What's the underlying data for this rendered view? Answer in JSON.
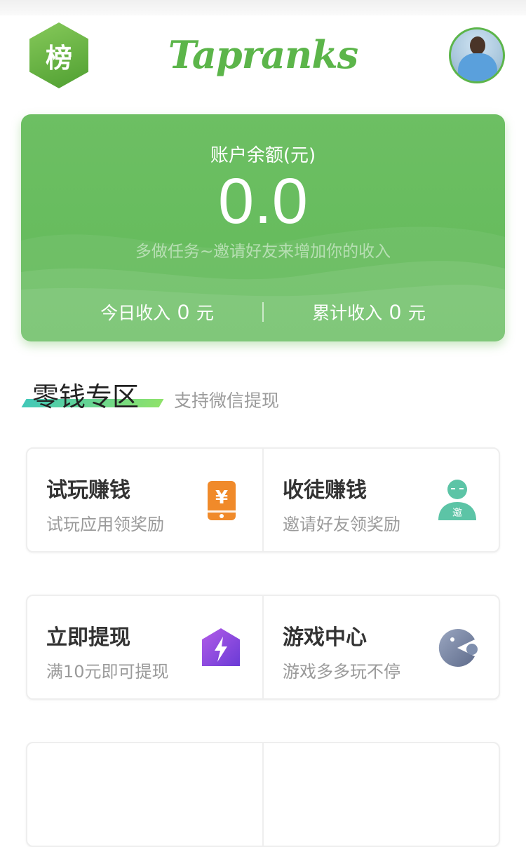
{
  "header": {
    "logo_char": "榜",
    "brand": "Tapranks"
  },
  "balance": {
    "label": "账户余额(元)",
    "amount": "0.0",
    "hint": "多做任务~邀请好友来增加你的收入",
    "today_label": "今日收入",
    "today_value": "0",
    "today_unit": "元",
    "total_label": "累计收入",
    "total_value": "0",
    "total_unit": "元"
  },
  "section": {
    "title": "零钱专区",
    "subtitle": "支持微信提现"
  },
  "features": [
    {
      "title": "试玩赚钱",
      "desc": "试玩应用领奖励",
      "icon": "yuan-phone-icon",
      "color": "#f08a2a"
    },
    {
      "title": "收徒赚钱",
      "desc": "邀请好友领奖励",
      "icon": "invite-person-icon",
      "color": "#5cc4a6",
      "badge": "邀"
    },
    {
      "title": "立即提现",
      "desc": "满10元即可提现",
      "icon": "lightning-icon",
      "color": "#8f4fe0"
    },
    {
      "title": "游戏中心",
      "desc": "游戏多多玩不停",
      "icon": "pacman-icon",
      "color": "#7f8fae"
    }
  ],
  "colors": {
    "brand_green": "#5cb54a",
    "card_green": "#66bc5d"
  }
}
